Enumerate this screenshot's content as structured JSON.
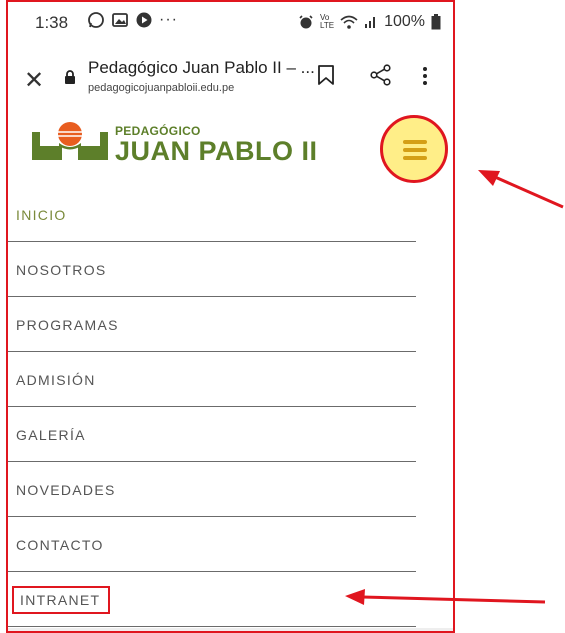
{
  "status_bar": {
    "time": "1:38",
    "icons": [
      "whatsapp-icon",
      "gallery-icon",
      "media-icon",
      "more-dots-icon"
    ],
    "right_icons": [
      "alarm-icon",
      "volte-icon",
      "wifi-icon",
      "signal-icon"
    ],
    "battery": "100%"
  },
  "browser": {
    "page_title": "Pedagógico Juan Pablo II – ...",
    "domain": "pedagogicojuanpabloii.edu.pe"
  },
  "site": {
    "logo_small": "PEDAGÓGICO",
    "logo_big": "JUAN PABLO II",
    "colors": {
      "brand_green": "#5d7f2a",
      "logo_orange": "#e85d20",
      "menu_button_bg": "#ffee88",
      "menu_bars": "#d4a017",
      "highlight_red": "#e0161f"
    }
  },
  "nav": {
    "items": [
      {
        "label": "INICIO",
        "active": true
      },
      {
        "label": "NOSOTROS"
      },
      {
        "label": "PROGRAMAS"
      },
      {
        "label": "ADMISIÓN"
      },
      {
        "label": "GALERÍA"
      },
      {
        "label": "NOVEDADES"
      },
      {
        "label": "CONTACTO"
      },
      {
        "label": "INTRANET"
      }
    ]
  }
}
